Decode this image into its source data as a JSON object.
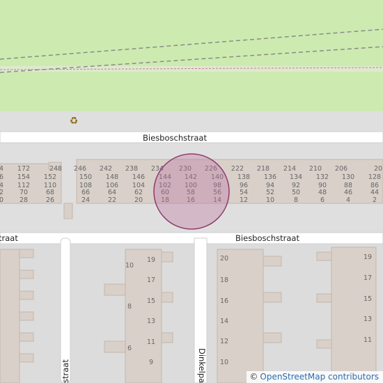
{
  "map": {
    "streets": {
      "top": "Biesboschstraat",
      "middle": "Biesboschstraat",
      "left_partial": "traat",
      "vertical_left": "straat",
      "vertical_right": "Dinkelpa"
    },
    "recycling_icon": "recycling-icon",
    "house_numbers_top_row": [
      "4",
      "172",
      "248",
      "246",
      "242",
      "238",
      "234",
      "230",
      "226",
      "222",
      "218",
      "214",
      "210",
      "206",
      "20"
    ],
    "house_numbers_row2": [
      "6",
      "154",
      "152",
      "150",
      "148",
      "146",
      "144",
      "142",
      "140",
      "138",
      "136",
      "134",
      "132",
      "130",
      "128"
    ],
    "house_numbers_row3": [
      "4",
      "112",
      "110",
      "108",
      "106",
      "104",
      "102",
      "100",
      "98",
      "96",
      "94",
      "92",
      "90",
      "88",
      "86"
    ],
    "house_numbers_row4": [
      "2",
      "70",
      "68",
      "66",
      "64",
      "62",
      "60",
      "58",
      "56",
      "54",
      "52",
      "50",
      "48",
      "46",
      "44"
    ],
    "house_numbers_row5": [
      "0",
      "28",
      "26",
      "24",
      "22",
      "20",
      "18",
      "16",
      "14",
      "12",
      "10",
      "8",
      "6",
      "4",
      "2"
    ],
    "lower_left_numbers_right": [
      "19",
      "17",
      "15",
      "13",
      "11",
      "9"
    ],
    "lower_left_numbers_left": [
      "10",
      "8",
      "6"
    ],
    "lower_right_numbers_left": [
      "20",
      "18",
      "16",
      "14",
      "12",
      "10"
    ],
    "lower_right_numbers_right": [
      "19",
      "17",
      "15",
      "13",
      "11"
    ],
    "colors": {
      "grass": "#cdebb0",
      "road": "#ffffff",
      "building": "#d9d0c9",
      "building_stroke": "#c4b6ab",
      "residential": "#e0dfdf",
      "marker_fill": "#b9709e",
      "marker_stroke": "#8e3b70",
      "rail_dash": "#8a8a8a",
      "boundary": "#c77a9a"
    }
  },
  "attribution": {
    "copyright": "©",
    "text": "OpenStreetMap contributors"
  }
}
